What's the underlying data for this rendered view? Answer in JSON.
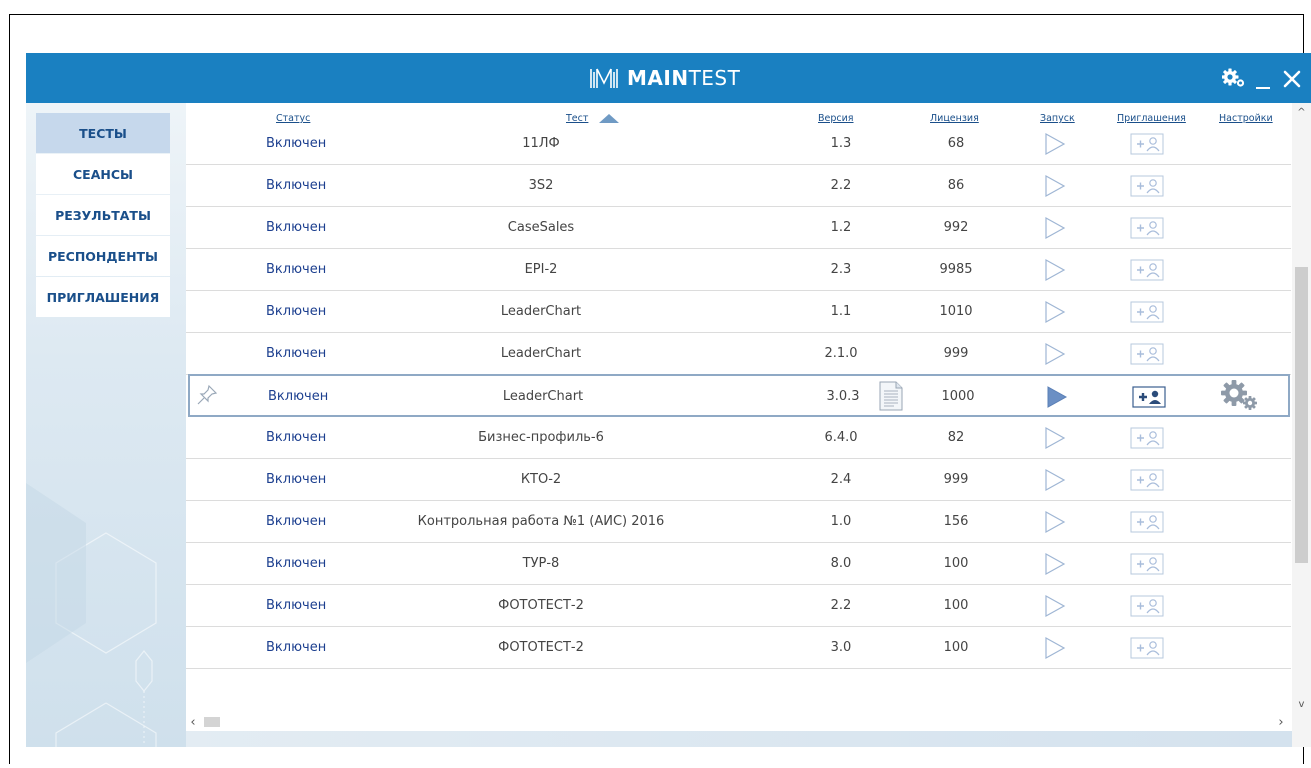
{
  "app": {
    "logo_bold": "MAIN",
    "logo_light": "TEST",
    "brand_color": "#1a80c1"
  },
  "titlebar": {
    "settings_icon": "gears-icon",
    "minimize_label": "__",
    "close_icon": "close-icon"
  },
  "sidebar": {
    "items": [
      {
        "label": "ТЕСТЫ",
        "active": true
      },
      {
        "label": "СЕАНСЫ",
        "active": false
      },
      {
        "label": "РЕЗУЛЬТАТЫ",
        "active": false
      },
      {
        "label": "РЕСПОНДЕНТЫ",
        "active": false
      },
      {
        "label": "ПРИГЛАШЕНИЯ",
        "active": false
      }
    ]
  },
  "table": {
    "headers": {
      "status": "Статус",
      "test": "Тест",
      "version": "Версия",
      "license": "Лицензия",
      "launch": "Запуск",
      "invitations": "Приглашения",
      "settings": "Настройки"
    },
    "sort_column": "test",
    "sort_direction": "asc",
    "rows": [
      {
        "status": "Включен",
        "test": "11ЛФ",
        "version": "1.3",
        "license": "68"
      },
      {
        "status": "Включен",
        "test": "3S2",
        "version": "2.2",
        "license": "86"
      },
      {
        "status": "Включен",
        "test": "CaseSales",
        "version": "1.2",
        "license": "992"
      },
      {
        "status": "Включен",
        "test": "EPI-2",
        "version": "2.3",
        "license": "9985"
      },
      {
        "status": "Включен",
        "test": "LeaderChart",
        "version": "1.1",
        "license": "1010"
      },
      {
        "status": "Включен",
        "test": "LeaderChart",
        "version": "2.1.0",
        "license": "999"
      },
      {
        "status": "Включен",
        "test": "LeaderChart",
        "version": "3.0.3",
        "license": "1000",
        "selected": true
      },
      {
        "status": "Включен",
        "test": "Бизнес-профиль-6",
        "version": "6.4.0",
        "license": "82"
      },
      {
        "status": "Включен",
        "test": "КТО-2",
        "version": "2.4",
        "license": "999"
      },
      {
        "status": "Включен",
        "test": "Контрольная работа №1 (АИС) 2016",
        "version": "1.0",
        "license": "156"
      },
      {
        "status": "Включен",
        "test": "ТУР-8",
        "version": "8.0",
        "license": "100"
      },
      {
        "status": "Включен",
        "test": "ФОТОТЕСТ-2",
        "version": "2.2",
        "license": "100"
      },
      {
        "status": "Включен",
        "test": "ФОТОТЕСТ-2",
        "version": "3.0",
        "license": "100"
      }
    ]
  }
}
